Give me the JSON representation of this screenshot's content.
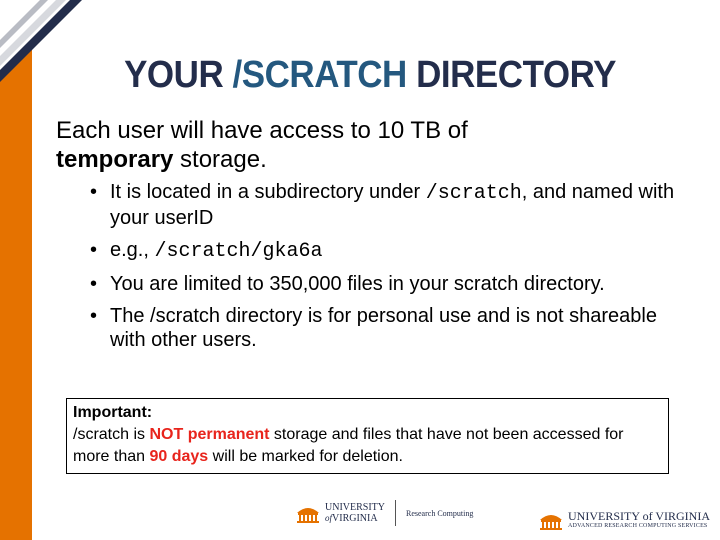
{
  "slide": {
    "title_prefix": "YOUR ",
    "title_path": "/SCRATCH",
    "title_suffix": " DIRECTORY",
    "lead_line1": "Each user will have access to 10 TB of",
    "lead_bold": "temporary",
    "lead_rest": " storage.",
    "bullets": {
      "b1_pre": "It is located in a subdirectory under ",
      "b1_code": "/scratch",
      "b1_post": ", and named with your userID",
      "b2_pre": "e.g., ",
      "b2_code": "/scratch/gka6a",
      "b3": "You are limited to 350,000 files in your scratch directory.",
      "b4": "The /scratch directory is for personal use and is not shareable with other users."
    },
    "notice": {
      "heading": "Important:",
      "t1": " /scratch is ",
      "red1": "NOT permanent",
      "t2": " storage and files that have not been accessed for more than ",
      "red2": "90 days",
      "t3": " will be marked for deletion."
    },
    "footer": {
      "uva_line1": "UNIVERSITY",
      "uva_line2": "VIRGINIA",
      "uva_of": "of",
      "rc_label": "Research Computing",
      "right_name": "UNIVERSITY of VIRGINIA",
      "right_sub": "ADVANCED RESEARCH COMPUTING SERVICES"
    },
    "colors": {
      "accent_orange": "#e57200",
      "navy": "#232d4b",
      "title_blue": "#24587f",
      "warning_red": "#e8241c"
    }
  }
}
